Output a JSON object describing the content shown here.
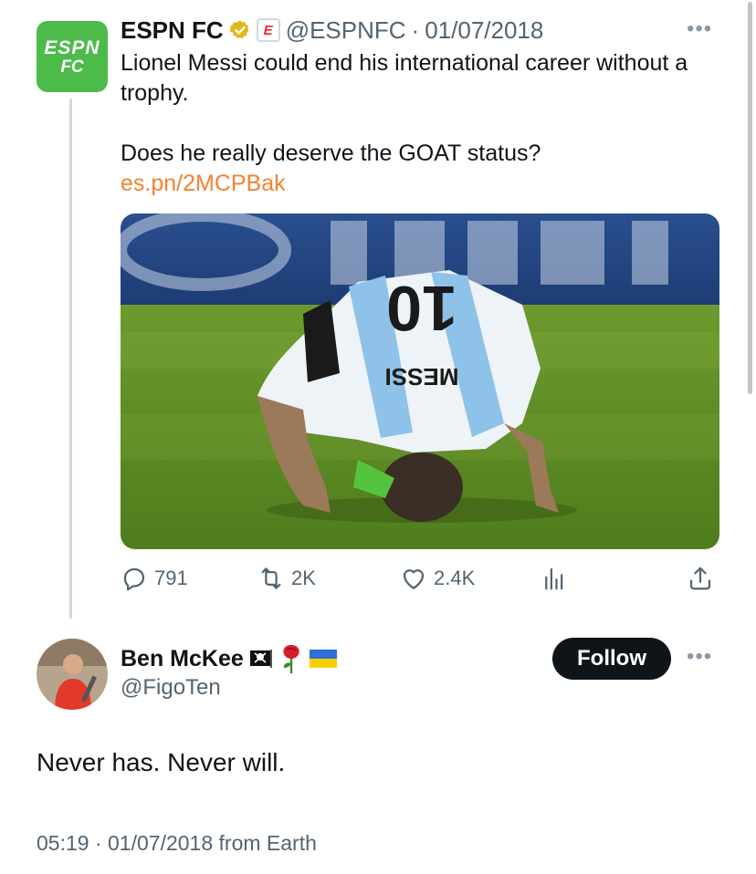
{
  "tweet": {
    "author_name": "ESPN FC",
    "author_avatar_text_top": "ESPN",
    "author_avatar_text_bottom": "FC",
    "affiliation_badge": "E",
    "handle": "@ESPNFC",
    "separator": "·",
    "date": "01/07/2018",
    "text_line1": "Lionel Messi could end his international career without a trophy.",
    "text_line2": "Does he really deserve the GOAT status?",
    "link": "es.pn/2MCPBak",
    "image_jersey_name": "MESSI",
    "image_jersey_number": "10",
    "more_icon": "more-horizontal-icon",
    "stats": {
      "replies": "791",
      "retweets": "2K",
      "likes": "2.4K"
    }
  },
  "reply": {
    "author_name": "Ben McKee",
    "handle": "@FigoTen",
    "flags": [
      "pirate-flag-icon",
      "rose-icon",
      "ukraine-flag-icon"
    ],
    "follow_label": "Follow",
    "text": "Never has. Never will.",
    "timestamp": "05:19",
    "date": "01/07/2018",
    "source": "from Earth"
  },
  "colors": {
    "link": "#f4812e",
    "espn_green": "#4cbb4a",
    "muted": "#536471",
    "follow_bg": "#0f1419",
    "verified_gold": "#e2b719"
  }
}
